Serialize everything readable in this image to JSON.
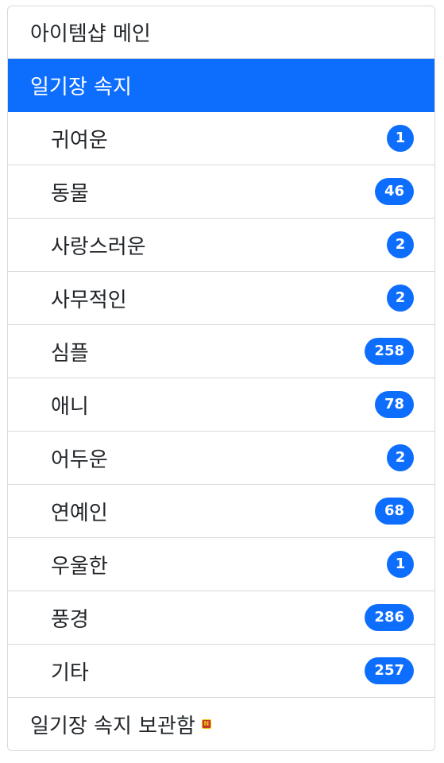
{
  "menu": {
    "main_label": "아이템샵 메인",
    "section_label": "일기장 속지",
    "categories": [
      {
        "label": "귀여운",
        "count": "1"
      },
      {
        "label": "동물",
        "count": "46"
      },
      {
        "label": "사랑스러운",
        "count": "2"
      },
      {
        "label": "사무적인",
        "count": "2"
      },
      {
        "label": "심플",
        "count": "258"
      },
      {
        "label": "애니",
        "count": "78"
      },
      {
        "label": "어두운",
        "count": "2"
      },
      {
        "label": "연예인",
        "count": "68"
      },
      {
        "label": "우울한",
        "count": "1"
      },
      {
        "label": "풍경",
        "count": "286"
      },
      {
        "label": "기타",
        "count": "257"
      }
    ],
    "archive_label": "일기장 속지 보관함",
    "new_badge": {
      "icon": "new-icon",
      "text": "N"
    }
  },
  "colors": {
    "accent": "#0d6efd",
    "text": "#212529",
    "border": "#d9d9d9"
  }
}
